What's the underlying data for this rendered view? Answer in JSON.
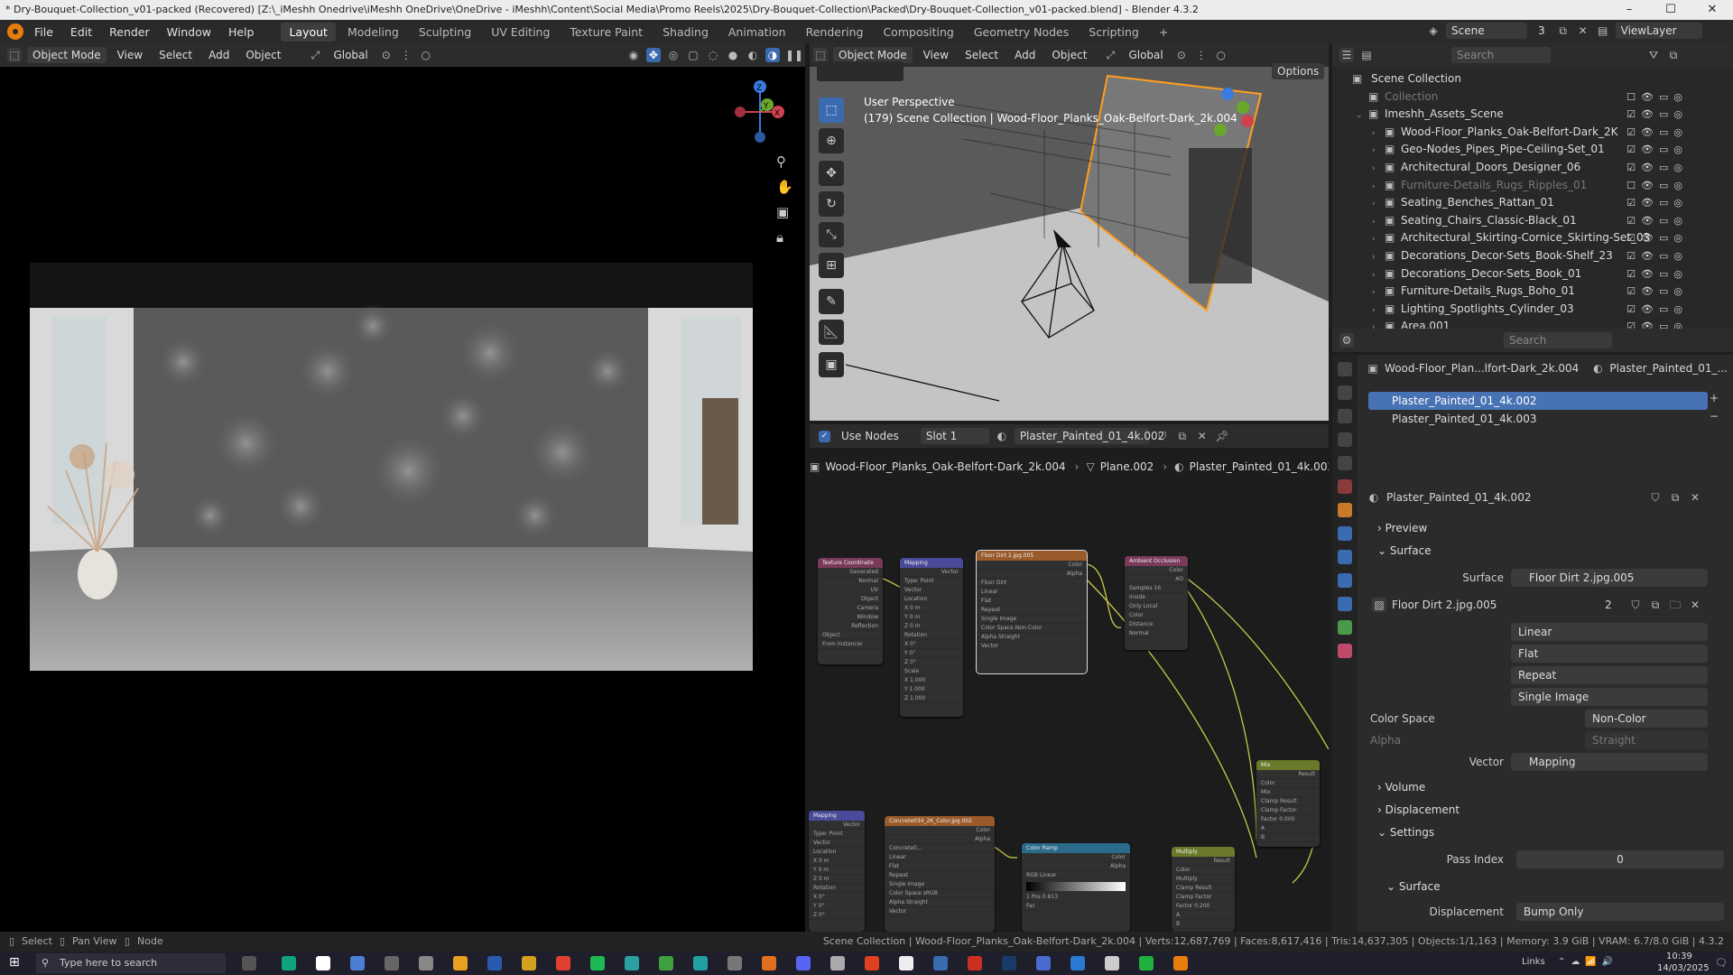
{
  "window": {
    "title": "* Dry-Bouquet-Collection_v01-packed (Recovered) [Z:\\_iMeshh Onedrive\\iMeshh OneDrive\\OneDrive - iMeshh\\Content\\Social Media\\Promo Reels\\2025\\Dry-Bouquet-Collection\\Packed\\Dry-Bouquet-Collection_v01-packed.blend] - Blender 4.3.2"
  },
  "menu": [
    "File",
    "Edit",
    "Render",
    "Window",
    "Help"
  ],
  "workspaces": [
    "Layout",
    "Modeling",
    "Sculpting",
    "UV Editing",
    "Texture Paint",
    "Shading",
    "Animation",
    "Rendering",
    "Compositing",
    "Geometry Nodes",
    "Scripting"
  ],
  "active_workspace": "Layout",
  "scene": {
    "name": "Scene",
    "count": "3",
    "view_layer": "ViewLayer"
  },
  "left_header": {
    "mode": "Object Mode",
    "items": [
      "View",
      "Select",
      "Add",
      "Object"
    ],
    "orientation": "Global"
  },
  "right_header": {
    "mode": "Object Mode",
    "items": [
      "View",
      "Select",
      "Add",
      "Object"
    ],
    "orientation": "Global",
    "options": "Options"
  },
  "viewport3d": {
    "perspective": "User Perspective",
    "info": "(179) Scene Collection | Wood-Floor_Planks_Oak-Belfort-Dark_2k.004"
  },
  "node_header": {
    "use_nodes": "Use Nodes",
    "slot": "Slot 1",
    "material": "Plaster_Painted_01_4k.002"
  },
  "breadcrumb": {
    "object": "Wood-Floor_Planks_Oak-Belfort-Dark_2k.004",
    "mesh": "Plane.002",
    "material": "Plaster_Painted_01_4k.002"
  },
  "nodes": {
    "texcoord": {
      "title": "Texture Coordinate",
      "rows": [
        "Generated",
        "Normal",
        "UV",
        "Object",
        "Camera",
        "Window",
        "Reflection",
        "Object",
        "From Instancer"
      ]
    },
    "mapping": {
      "title": "Mapping",
      "rows": [
        "Vector",
        "Type: Point",
        "Vector",
        "Location",
        "X 0 m",
        "Y 0 m",
        "Z 0 m",
        "Rotation",
        "X 0°",
        "Y 0°",
        "Z 0°",
        "Scale",
        "X 1.000",
        "Y 1.000",
        "Z 1.000"
      ]
    },
    "image": {
      "title": "Floor Dirt 2.jpg.005",
      "rows": [
        "Color",
        "Alpha",
        "Floor Dirt",
        "Linear",
        "Flat",
        "Repeat",
        "Single Image",
        "Color Space   Non-Color",
        "Alpha   Straight",
        "Vector"
      ]
    },
    "ao": {
      "title": "Ambient Occlusion",
      "rows": [
        "Color",
        "AO",
        "Samples 16",
        "Inside",
        "Only Local",
        "Color",
        "Distance",
        "Normal"
      ]
    },
    "mix": {
      "title": "Mix",
      "rows": [
        "Result",
        "Color",
        "Mix",
        "Clamp Result",
        "Clamp Factor",
        "Factor 0.000",
        "A",
        "B"
      ]
    },
    "mapping2": {
      "title": "Mapping",
      "rows": [
        "Vector",
        "Type: Point",
        "Vector",
        "Location",
        "X 0 m",
        "Y 0 m",
        "Z 0 m",
        "Rotation",
        "X 0°",
        "Y 0°",
        "Z 0°"
      ]
    },
    "concrete": {
      "title": "Concrete034_2K_Color.jpg.002",
      "rows": [
        "Color",
        "Alpha",
        "Concrete0...",
        "Linear",
        "Flat",
        "Repeat",
        "Single Image",
        "Color Space   sRGB",
        "Alpha   Straight",
        "Vector"
      ]
    },
    "ramp": {
      "title": "Color Ramp",
      "rows": [
        "Color",
        "Alpha",
        "RGB   Linear",
        "1   Pos 0.813",
        "Fac"
      ]
    },
    "multiply": {
      "title": "Multiply",
      "rows": [
        "Result",
        "Color",
        "Multiply",
        "Clamp Result",
        "Clamp Factor",
        "Factor 0.200",
        "A",
        "B"
      ]
    }
  },
  "outliner": {
    "search": "Search",
    "root": "Scene Collection",
    "items": [
      {
        "name": "Collection",
        "indent": 1,
        "dim": true
      },
      {
        "name": "Imeshh_Assets_Scene",
        "indent": 1,
        "dim": false
      },
      {
        "name": "Wood-Floor_Planks_Oak-Belfort-Dark_2K",
        "indent": 2,
        "dim": false
      },
      {
        "name": "Geo-Nodes_Pipes_Pipe-Ceiling-Set_01",
        "indent": 2,
        "dim": false
      },
      {
        "name": "Architectural_Doors_Designer_06",
        "indent": 2,
        "dim": false
      },
      {
        "name": "Furniture-Details_Rugs_Ripples_01",
        "indent": 2,
        "dim": true
      },
      {
        "name": "Seating_Benches_Rattan_01",
        "indent": 2,
        "dim": false
      },
      {
        "name": "Seating_Chairs_Classic-Black_01",
        "indent": 2,
        "dim": false
      },
      {
        "name": "Architectural_Skirting-Cornice_Skirting-Set_03",
        "indent": 2,
        "dim": false
      },
      {
        "name": "Decorations_Decor-Sets_Book-Shelf_23",
        "indent": 2,
        "dim": false
      },
      {
        "name": "Decorations_Decor-Sets_Book_01",
        "indent": 2,
        "dim": false
      },
      {
        "name": "Furniture-Details_Rugs_Boho_01",
        "indent": 2,
        "dim": false
      },
      {
        "name": "Lighting_Spotlights_Cylinder_03",
        "indent": 2,
        "dim": false
      },
      {
        "name": "Area.001",
        "indent": 2,
        "dim": false
      }
    ]
  },
  "properties": {
    "search": "Search",
    "object": "Wood-Floor_Plan...lfort-Dark_2k.004",
    "material_short": "Plaster_Painted_01_...",
    "slots": [
      "Plaster_Painted_01_4k.002",
      "Plaster_Painted_01_4k.003"
    ],
    "material": "Plaster_Painted_01_4k.002",
    "preview": "Preview",
    "surface_section": "Surface",
    "surface_label": "Surface",
    "surface_value": "Floor Dirt 2.jpg.005",
    "image_name": "Floor Dirt 2.jpg.005",
    "image_users": "2",
    "interp": "Linear",
    "projection": "Flat",
    "extension": "Repeat",
    "source": "Single Image",
    "color_space_label": "Color Space",
    "color_space": "Non-Color",
    "alpha_label": "Alpha",
    "alpha": "Straight",
    "vector_label": "Vector",
    "vector": "Mapping",
    "volume": "Volume",
    "displacement_section": "Displacement",
    "settings": "Settings",
    "pass_index_label": "Pass Index",
    "pass_index": "0",
    "surface_sub": "Surface",
    "displacement_label": "Displacement",
    "displacement": "Bump Only"
  },
  "statusbar": {
    "select": "Select",
    "pan": "Pan View",
    "node": "Node",
    "stats": "Scene Collection | Wood-Floor_Planks_Oak-Belfort-Dark_2k.004 | Verts:12,687,769 | Faces:8,617,416 | Tris:14,637,305 | Objects:1/1,163 | Memory: 3.9 GiB | VRAM: 6.7/8.0 GiB | 4.3.2"
  },
  "taskbar": {
    "search": "Type here to search",
    "links": "Links",
    "time": "10:39",
    "date": "14/03/2025"
  }
}
